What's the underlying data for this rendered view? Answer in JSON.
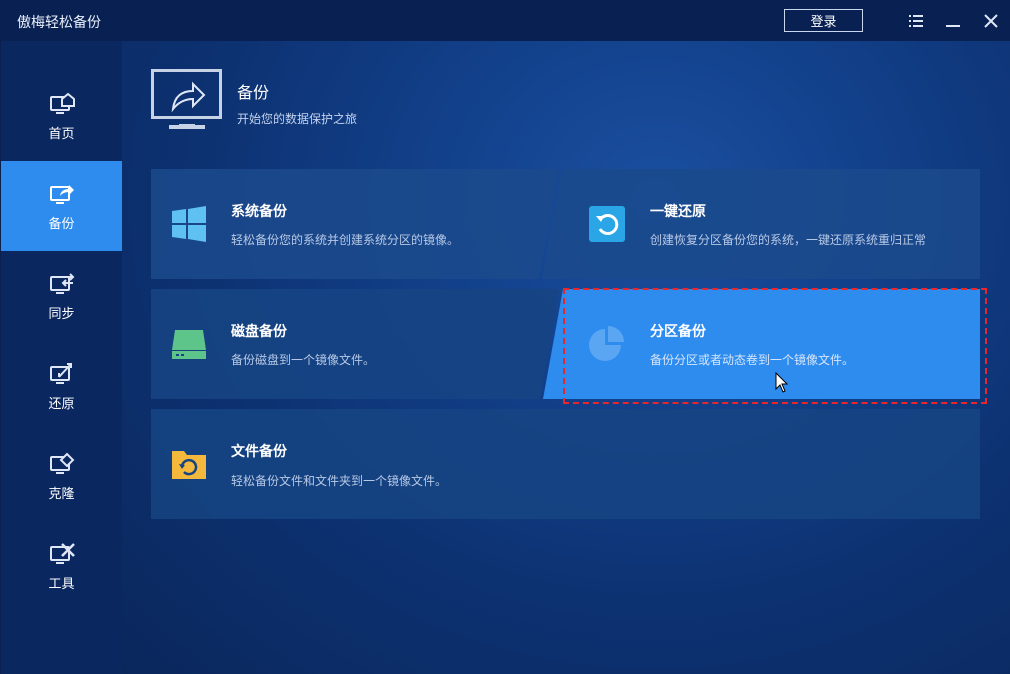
{
  "app": {
    "title": "傲梅轻松备份",
    "login_label": "登录"
  },
  "titlebar_icons": [
    "menu-icon",
    "minimize-icon",
    "close-icon"
  ],
  "sidebar": {
    "items": [
      {
        "label": "首页",
        "icon": "home-icon",
        "active": false
      },
      {
        "label": "备份",
        "icon": "backup-icon",
        "active": true
      },
      {
        "label": "同步",
        "icon": "sync-icon",
        "active": false
      },
      {
        "label": "还原",
        "icon": "restore-icon",
        "active": false
      },
      {
        "label": "克隆",
        "icon": "clone-icon",
        "active": false
      },
      {
        "label": "工具",
        "icon": "tools-icon",
        "active": false
      }
    ]
  },
  "header": {
    "title": "备份",
    "subtitle": "开始您的数据保护之旅"
  },
  "cards": [
    {
      "title": "系统备份",
      "desc": "轻松备份您的系统并创建系统分区的镜像。",
      "icon": "windows-icon"
    },
    {
      "title": "一键还原",
      "desc": "创建恢复分区备份您的系统，一键还原系统重归正常",
      "icon": "one-key-restore-icon"
    },
    {
      "title": "磁盘备份",
      "desc": "备份磁盘到一个镜像文件。",
      "icon": "disk-icon"
    },
    {
      "title": "分区备份",
      "desc": "备份分区或者动态卷到一个镜像文件。",
      "icon": "partition-icon"
    },
    {
      "title": "文件备份",
      "desc": "轻松备份文件和文件夹到一个镜像文件。",
      "icon": "folder-icon"
    }
  ],
  "colors": {
    "accent": "#2f8cef",
    "highlight_border": "#e8262c",
    "sidebar": "#0a2760"
  }
}
